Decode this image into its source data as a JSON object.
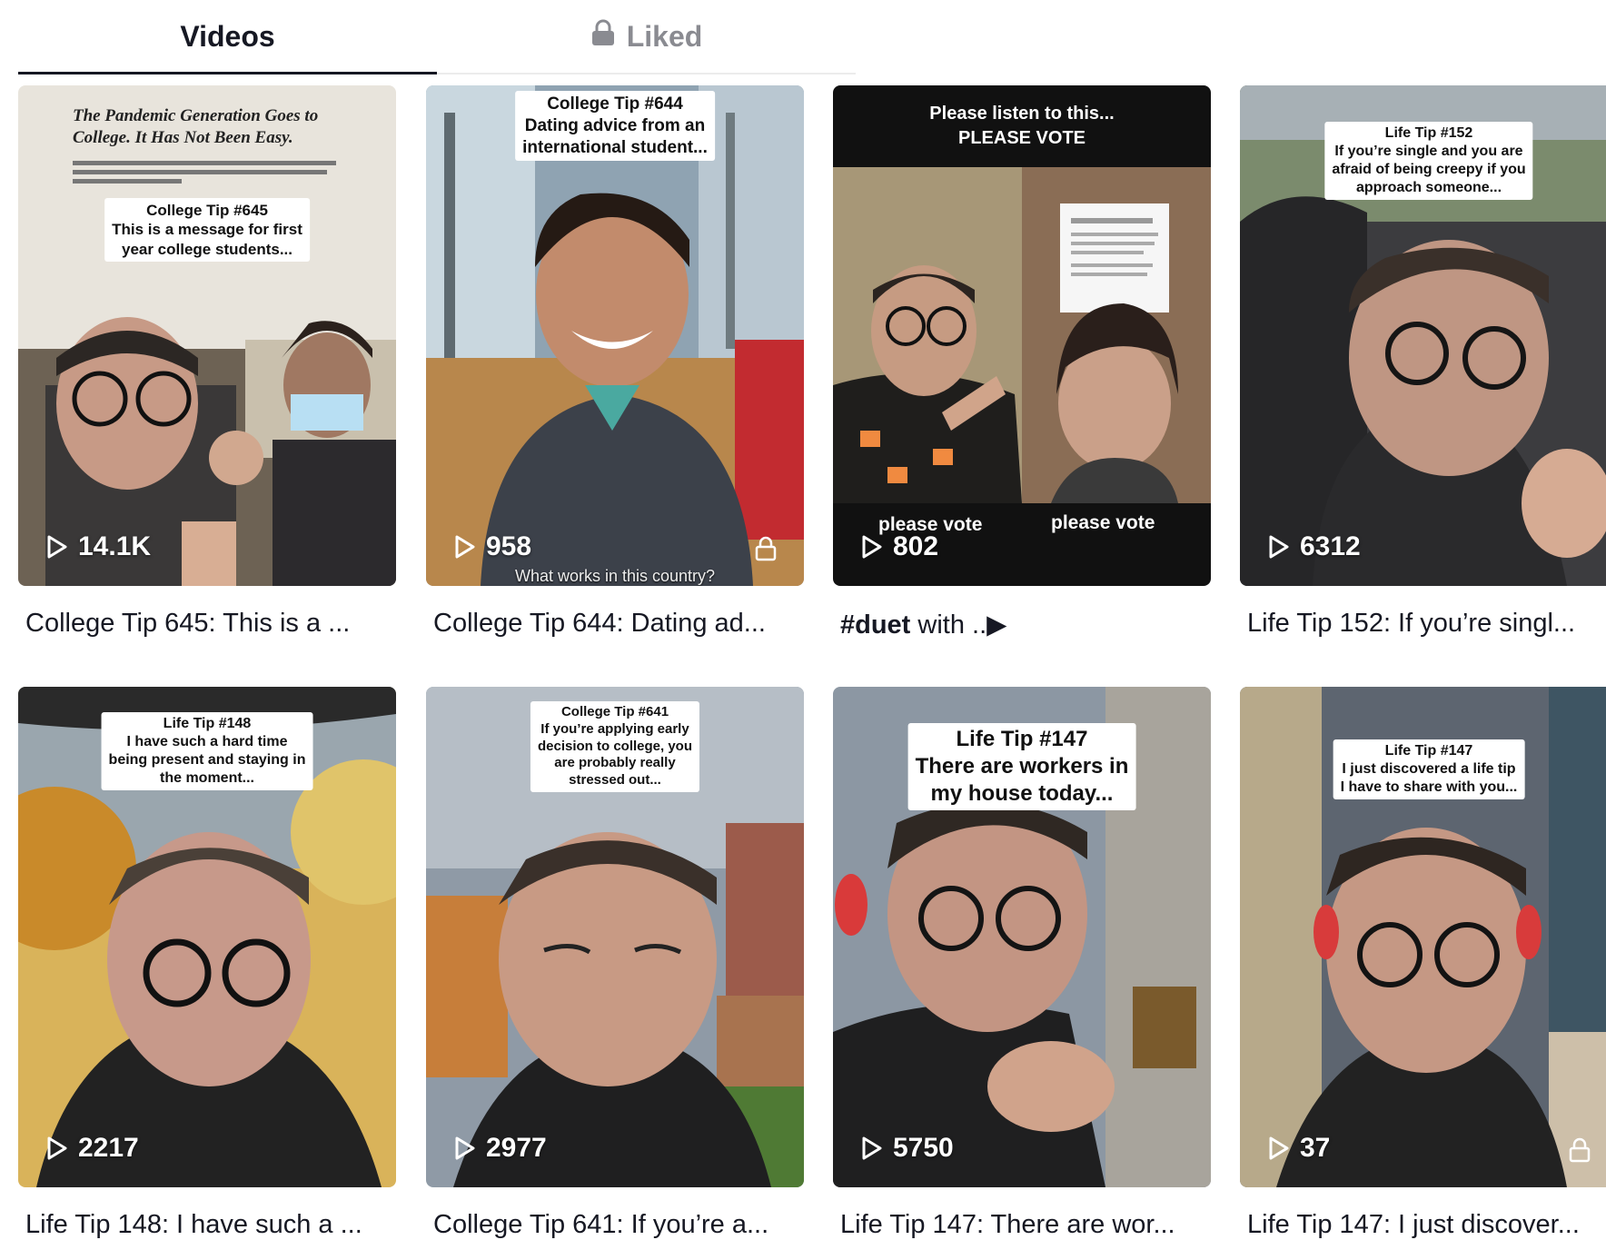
{
  "tabs": {
    "videos": "Videos",
    "liked": "Liked"
  },
  "videos": [
    {
      "views": "14.1K",
      "title": "College Tip 645: This is a ...",
      "headline1": "The Pandemic Generation Goes to",
      "headline2": "College. It Has Not Been Easy.",
      "caption": [
        "College Tip #645",
        "This is a message for first",
        "year college students..."
      ]
    },
    {
      "views": "958",
      "title": "College Tip 644: Dating ad...",
      "caption": [
        "College Tip #644",
        "Dating advice from an",
        "international student..."
      ],
      "subtitle": "What works in this country?"
    },
    {
      "views": "802",
      "title_hashtag": "#duet",
      "title_rest": " with ..▶",
      "banner": [
        "Please listen to this...",
        "PLEASE VOTE"
      ],
      "left_label": "please vote",
      "right_label": "please vote"
    },
    {
      "views": "6312",
      "title": "Life Tip 152: If you’re singl...",
      "caption": [
        "Life Tip #152",
        "If you’re single and you are",
        "afraid of being creepy if you",
        "approach someone..."
      ]
    },
    {
      "views": "2217",
      "title": "Life Tip 148: I have such a ...",
      "caption": [
        "Life Tip #148",
        "I have such a hard time",
        "being present and staying in",
        "the moment..."
      ]
    },
    {
      "views": "2977",
      "title": "College Tip 641: If you’re a...",
      "caption": [
        "College Tip #641",
        "If you’re applying early",
        "decision to college, you",
        "are probably really",
        "stressed out..."
      ]
    },
    {
      "views": "5750",
      "title": "Life Tip 147: There are wor...",
      "caption": [
        "Life Tip #147",
        "There are workers in",
        "my house today..."
      ]
    },
    {
      "views": "37",
      "title": "Life Tip 147: I just discover...",
      "caption": [
        "Life Tip #147",
        "I just discovered a life tip",
        "I have to share with you..."
      ]
    }
  ],
  "colors": {
    "text": "#161823",
    "muted": "#8a8b91",
    "tab_underline": "#161823"
  }
}
